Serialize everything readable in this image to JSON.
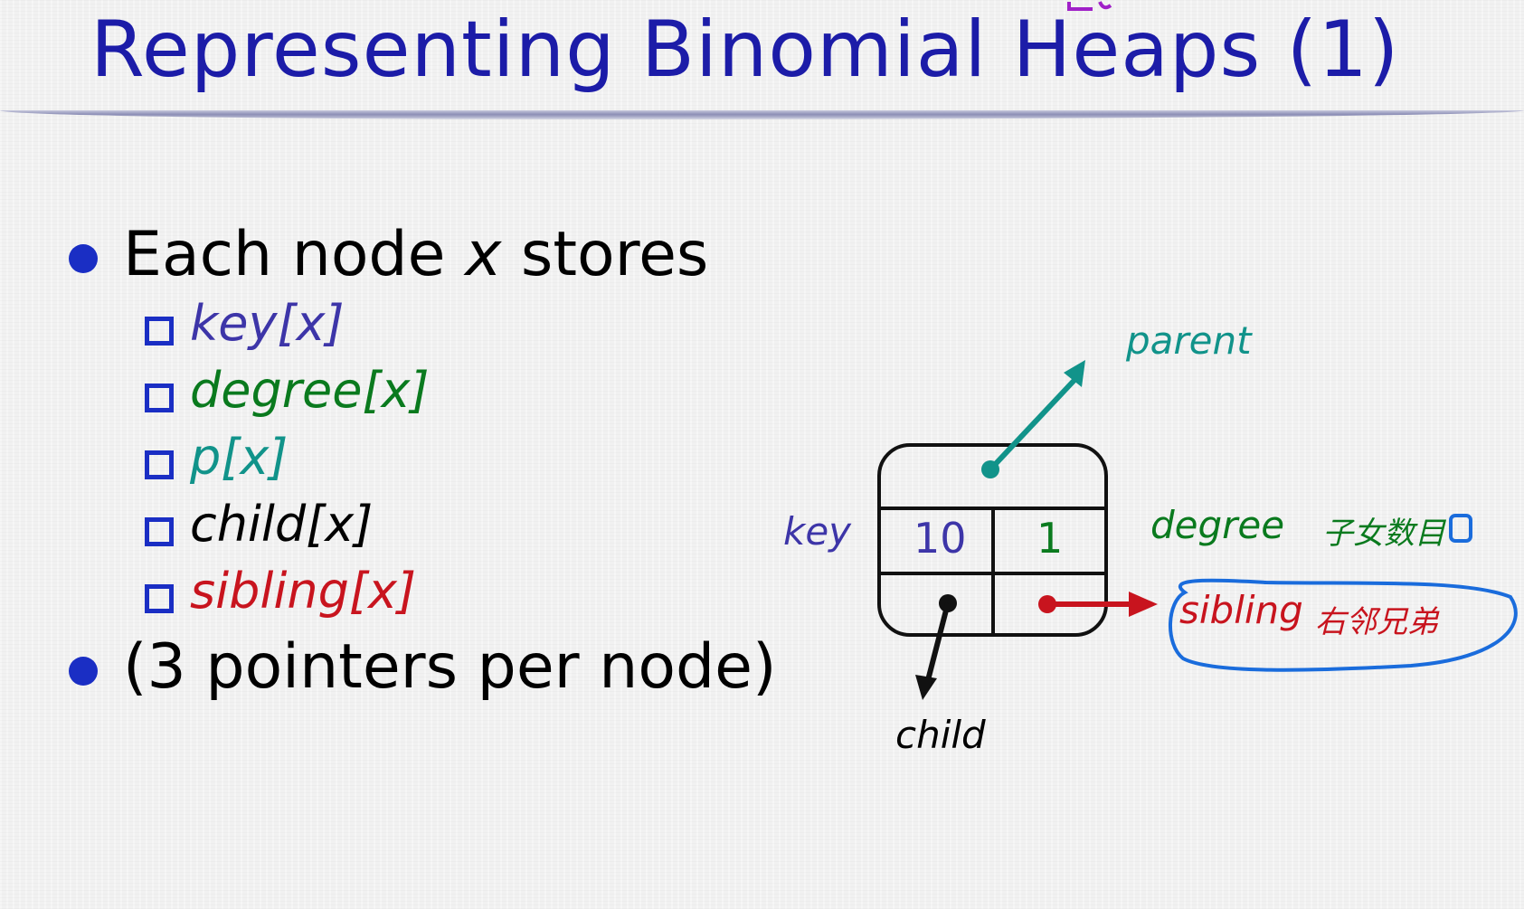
{
  "slide": {
    "title": "Representing Binomial Heaps (1)"
  },
  "bullets": [
    {
      "text": "Each node ",
      "var": "x",
      "rest": " stores"
    },
    {
      "text": "(3 pointers per node)"
    }
  ],
  "fields": [
    {
      "name": "key",
      "arg": "[x]",
      "color": "#3d35a8"
    },
    {
      "name": "degree",
      "arg": "[x]",
      "color": "#0a7a1e"
    },
    {
      "name": "p",
      "arg": "[x]",
      "color": "#11938a"
    },
    {
      "name": "child",
      "arg": "[x]",
      "color": "#000000"
    },
    {
      "name": "sibling",
      "arg": "[x]",
      "color": "#c8141e"
    }
  ],
  "node_diagram": {
    "key_value": "10",
    "degree_value": "1",
    "labels": {
      "parent": "parent",
      "key": "key",
      "degree": "degree",
      "child": "child",
      "sibling": "sibling"
    },
    "annotations": {
      "degree_note": "子女数目",
      "sibling_note": "右邻兄弟"
    },
    "colors": {
      "parent": "#11938a",
      "key": "#3d35a8",
      "degree": "#0a7a1e",
      "child": "#000000",
      "sibling": "#c8141e",
      "highlight_circle": "#1a6cdc"
    }
  }
}
